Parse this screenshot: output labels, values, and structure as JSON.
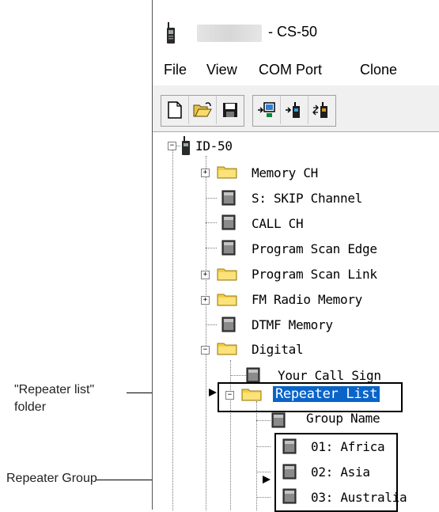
{
  "window": {
    "title_suffix": "- CS-50"
  },
  "menu": [
    "File",
    "View",
    "COM Port",
    "Clone"
  ],
  "toolbar": {
    "groups": [
      [
        "new-file-icon",
        "open-folder-icon",
        "save-disk-icon"
      ],
      [
        "read-from-radio-icon",
        "write-to-radio-icon",
        "clone-radio-icon"
      ]
    ]
  },
  "tree": {
    "root": "ID-50",
    "items": {
      "memory_ch": "Memory CH",
      "s_skip": "S: SKIP Channel",
      "call_ch": "CALL CH",
      "program_scan_edge": "Program Scan Edge",
      "program_scan_link": "Program Scan Link",
      "fm_radio_memory": "FM Radio Memory",
      "dtmf_memory": "DTMF Memory",
      "digital": "Digital",
      "your_call_sign": "Your Call Sign",
      "repeater_list": "Repeater List",
      "group_name": "Group Name",
      "group_01": "01: Africa",
      "group_02": "02: Asia",
      "group_03": "03: Australia"
    }
  },
  "callouts": {
    "repeater_list_folder": [
      "\"Repeater list\"",
      "folder"
    ],
    "repeater_group": "Repeater Group"
  },
  "colors": {
    "selection": "#0a64c8",
    "folder": "#f2cf42"
  }
}
